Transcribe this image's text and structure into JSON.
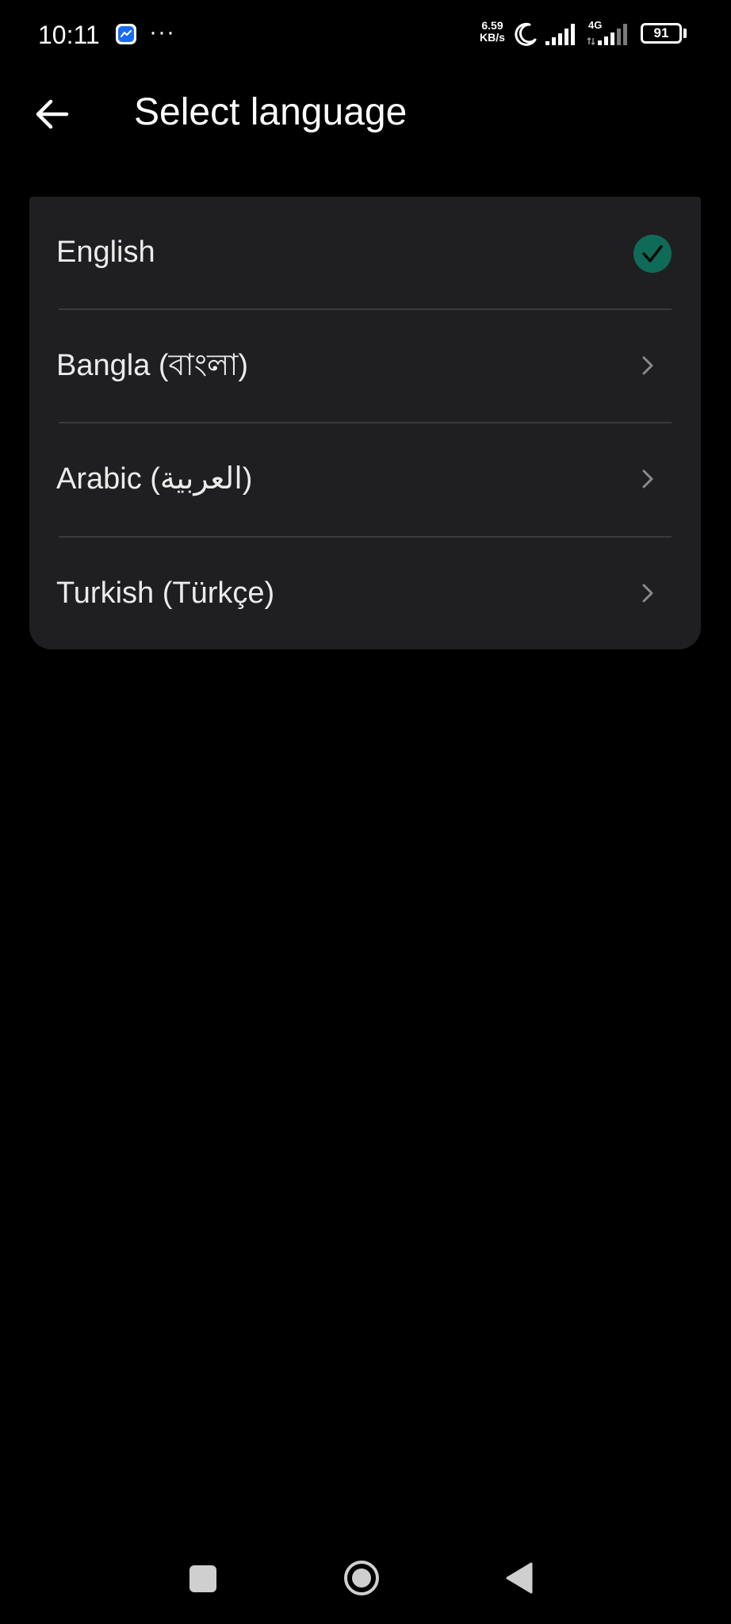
{
  "status_bar": {
    "time": "10:11",
    "notification_icon": "messenger-icon",
    "overflow_dots": "···",
    "net_speed_value": "6.59",
    "net_speed_unit": "KB/s",
    "network_type": "4G",
    "battery_level": "91",
    "icons": [
      "moon-icon",
      "signal-icon",
      "signal-icon",
      "battery-icon"
    ]
  },
  "header": {
    "back_icon": "arrow-left-icon",
    "title": "Select language"
  },
  "languages": {
    "items": [
      {
        "label": "English",
        "selected": true,
        "trailing_icon": "check-circle-icon"
      },
      {
        "label": "Bangla (বাংলা)",
        "selected": false,
        "trailing_icon": "chevron-right-icon"
      },
      {
        "label": "Arabic (العربية)",
        "selected": false,
        "trailing_icon": "chevron-right-icon"
      },
      {
        "label": "Turkish (Türkçe)",
        "selected": false,
        "trailing_icon": "chevron-right-icon"
      }
    ]
  },
  "navigation_bar": {
    "icons": [
      "recents-icon",
      "home-icon",
      "back-triangle-icon"
    ]
  },
  "colors": {
    "background": "#000000",
    "card": "#1f1f22",
    "divider": "#3a3a3d",
    "accent_check": "#0f6b58",
    "text_primary": "#ebebeb",
    "chevron": "#8a8a8d"
  }
}
